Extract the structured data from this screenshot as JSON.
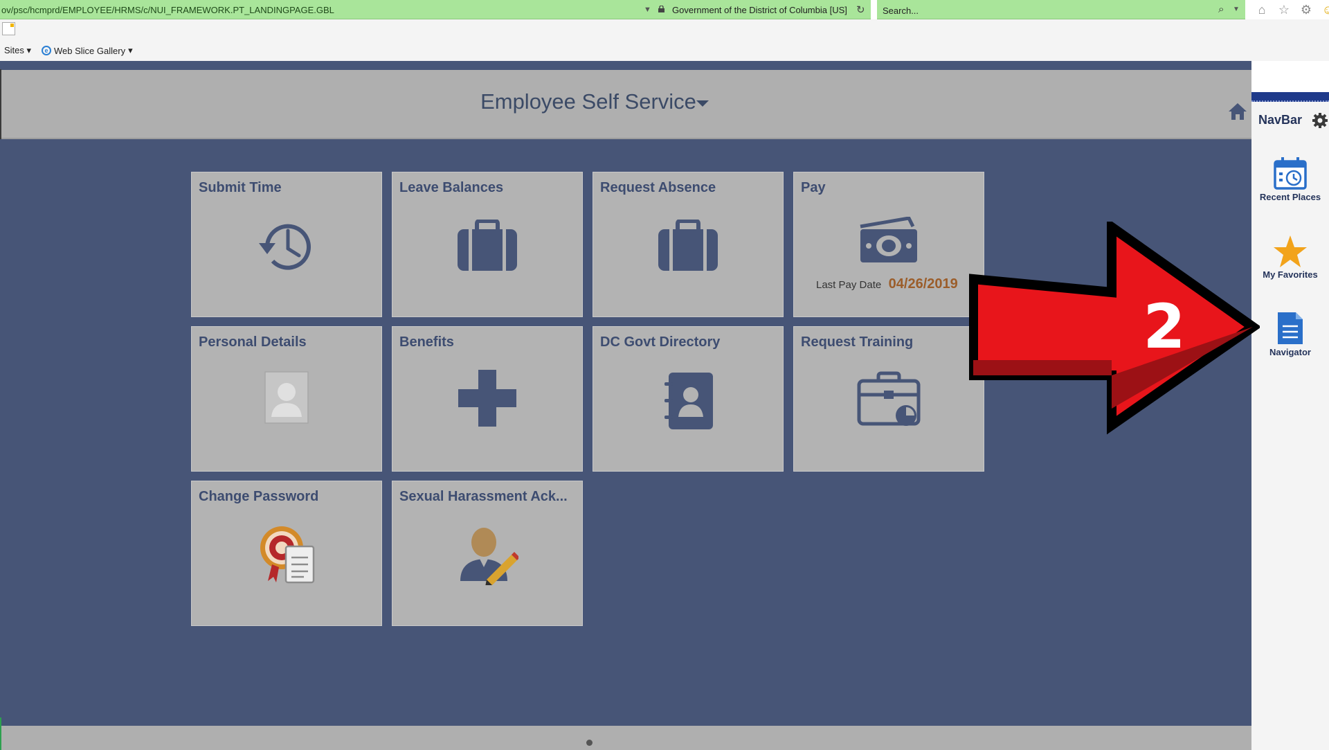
{
  "browser": {
    "url": "ov/psc/hcmprd/EMPLOYEE/HRMS/c/NUI_FRAMEWORK.PT_LANDINGPAGE.GBL",
    "site_identity": "Government of the District of Columbia [US]",
    "search_placeholder": "Search...",
    "favorites": {
      "sites_label": "Sites",
      "web_slice_label": "Web Slice Gallery"
    }
  },
  "header": {
    "title": "Employee Self Service"
  },
  "tiles": [
    {
      "title": "Submit Time",
      "icon": "clock-history-icon"
    },
    {
      "title": "Leave Balances",
      "icon": "briefcase-icon"
    },
    {
      "title": "Request Absence",
      "icon": "briefcase-icon"
    },
    {
      "title": "Pay",
      "icon": "money-icon",
      "last_pay_date_label": "Last Pay Date",
      "last_pay_date": "04/26/2019"
    },
    {
      "title": "Personal Details",
      "icon": "person-photo-icon"
    },
    {
      "title": "Benefits",
      "icon": "plus-icon"
    },
    {
      "title": "DC Govt Directory",
      "icon": "address-book-icon"
    },
    {
      "title": "Request Training",
      "icon": "training-briefcase-icon"
    },
    {
      "title": "Change Password",
      "icon": "certificate-icon"
    },
    {
      "title": "Sexual Harassment Ack...",
      "icon": "user-edit-icon"
    }
  ],
  "navbar": {
    "title": "NavBar",
    "items": [
      {
        "label": "Recent Places",
        "icon": "calendar-clock-icon"
      },
      {
        "label": "My Favorites",
        "icon": "star-icon"
      },
      {
        "label": "Navigator",
        "icon": "document-icon"
      }
    ]
  },
  "annotation": {
    "step_number": "2",
    "arrow_color": "#e8151b"
  },
  "colors": {
    "page_background": "#475577",
    "tile_background": "#b3b3b3",
    "tile_title": "#3d4c70",
    "pay_date": "#9b5d2a",
    "address_bar": "#a9e59a"
  }
}
